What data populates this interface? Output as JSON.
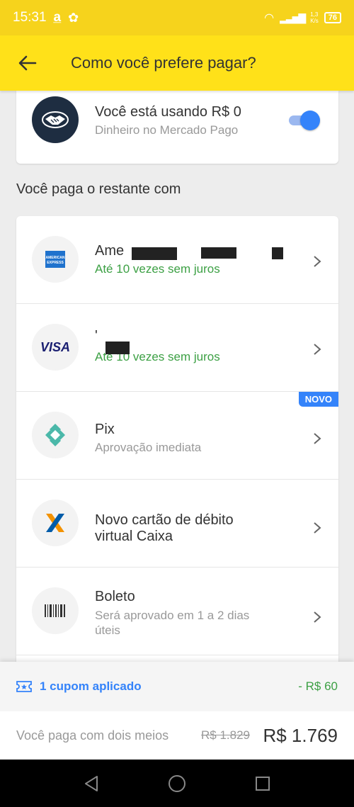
{
  "status_bar": {
    "time": "15:31",
    "speed": "1,3\nK/s",
    "battery": "76"
  },
  "header": {
    "title": "Como você prefere pagar?"
  },
  "balance": {
    "title": "Você está usando R$ 0",
    "subtitle": "Dinheiro no Mercado Pago",
    "toggle_on": true
  },
  "section_heading": "Você paga o restante com",
  "methods": [
    {
      "title": "Ame",
      "subtitle": "Até 10 vezes sem juros",
      "icon": "amex-card-icon"
    },
    {
      "title": "'",
      "subtitle": "Até 10 vezes sem juros",
      "icon": "visa-card-icon",
      "brand": "VISA"
    },
    {
      "title": "Pix",
      "subtitle": "Aprovação imediata",
      "icon": "pix-icon",
      "badge": "NOVO"
    },
    {
      "title": "Novo cartão de débito virtual Caixa",
      "title_line1": "Novo cartão de débito",
      "title_line2": "virtual Caixa",
      "icon": "caixa-icon"
    },
    {
      "title": "Boleto",
      "subtitle": "Será aprovado em 1 a 2 dias úteis",
      "subtitle_line1": "Será aprovado em 1 a 2 dias",
      "subtitle_line2": "úteis",
      "icon": "barcode-icon"
    }
  ],
  "footer": {
    "coupon_label": "1 cupom aplicado",
    "coupon_value": "- R$ 60",
    "total_label": "Você paga com dois meios",
    "total_old": "R$ 1.829",
    "total_value": "R$ 1.769"
  },
  "colors": {
    "status_bar": "#f6d31c",
    "app_bar": "#ffe119",
    "accent_blue": "#3483fa",
    "green": "#3ca044"
  }
}
